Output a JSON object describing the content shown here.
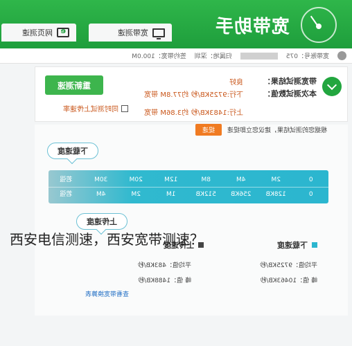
{
  "header": {
    "title": "宽带助手",
    "tabs": [
      {
        "label": "宽带测速"
      },
      {
        "label": "网页测速"
      }
    ]
  },
  "info_bar": {
    "account_label": "宽带账号：075",
    "isp_label": "归属地：深圳",
    "package_label": "签约带宽：100.0M"
  },
  "result": {
    "result_label": "带宽测试结果：",
    "result_value": "良好",
    "measured_label": "本次测试数值：",
    "down_value": "下行:9725KB/秒 约77.8M 带宽",
    "up_value": "上行:1483KB/秒 约3.86M 带宽",
    "retest_label": "重新测速",
    "upload_checkbox_label": "同时测试上传速率"
  },
  "advice": {
    "text": "根据您的测试结果，建议您立即提速",
    "button_label": "提速"
  },
  "download_bubble": "下载速度",
  "upload_bubble": "上传速度",
  "scale_top": [
    "0",
    "2M",
    "4M",
    "8M",
    "12M",
    "20M",
    "30M",
    "若强"
  ],
  "scale_bottom": [
    "0",
    "128KB",
    "256KB",
    "512KB",
    "1M",
    "2M",
    "4M",
    "若强"
  ],
  "legend": {
    "download": "下载速度",
    "upload": "上传速度"
  },
  "stats": {
    "down_avg": "平均值：9725KB/秒",
    "down_peak": "峰  值：10463KB/秒",
    "up_avg": "平均值：483KB/秒",
    "up_peak": "峰  值：1488KB/秒"
  },
  "link_text": "查看带宽换算表",
  "caption": "西安电信测速，西安宽带测速？",
  "colors": {
    "brand_green": "#1e9e3c",
    "accent_orange": "#f07b22",
    "scale_cyan": "#2bb6cf",
    "download_legend": "#2bb6cf",
    "upload_legend": "#444444"
  }
}
